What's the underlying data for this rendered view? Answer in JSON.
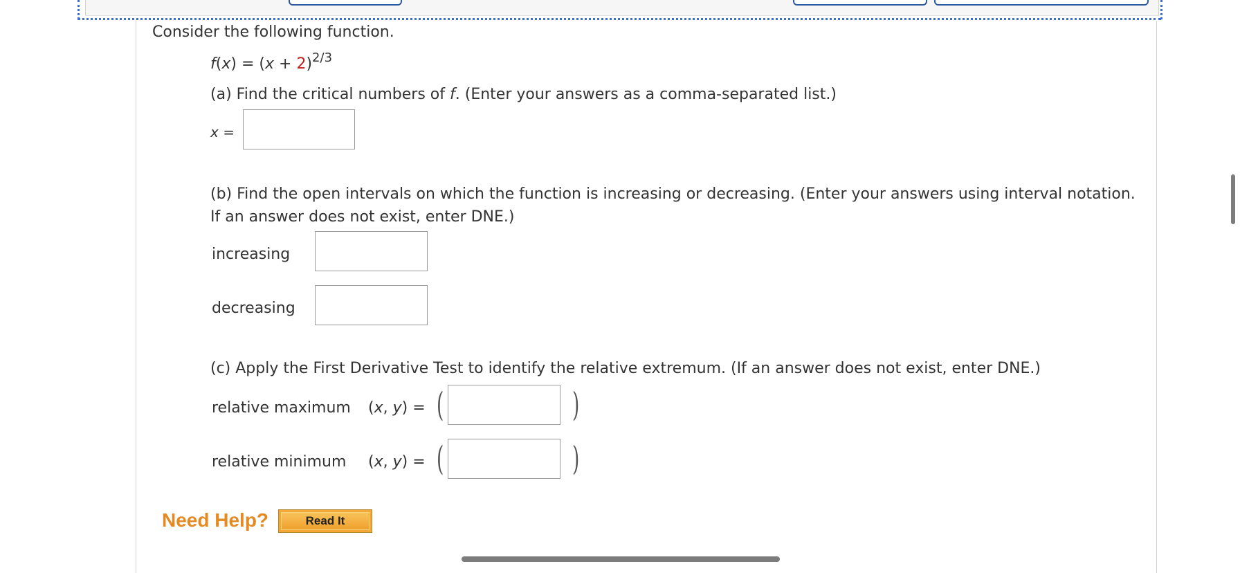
{
  "problem": {
    "intro": "Consider the following function.",
    "function": {
      "lhs_name": "f",
      "lhs_var": "x",
      "equals": "=",
      "open": "(",
      "var": "x",
      "plus": "+",
      "constant": "2",
      "close": ")",
      "exponent": "2/3"
    }
  },
  "part_a": {
    "prompt_before": "(a) Find the critical numbers of ",
    "prompt_var": "f",
    "prompt_after": ". (Enter your answers as a comma-separated list.)",
    "answer_label_var": "x",
    "answer_label_eq": "=",
    "answer_value": ""
  },
  "part_b": {
    "prompt": "(b) Find the open intervals on which the function is increasing or decreasing. (Enter your answers using interval notation. If an answer does not exist, enter DNE.)",
    "increasing_label": "increasing",
    "increasing_value": "",
    "decreasing_label": "decreasing",
    "decreasing_value": ""
  },
  "part_c": {
    "prompt": "(c) Apply the First Derivative Test to identify the relative extremum. (If an answer does not exist, enter DNE.)",
    "max_label": "relative maximum",
    "min_label": "relative minimum",
    "pair_open": "(",
    "pair_x": "x",
    "pair_comma": ", ",
    "pair_y": "y",
    "pair_close": ")",
    "pair_eq": "=",
    "paren_open": "(",
    "paren_close": ")",
    "max_value": "",
    "min_value": ""
  },
  "help": {
    "label": "Need Help?",
    "read_it": "Read It"
  },
  "colors": {
    "accent_red": "#c11c1c",
    "help_orange": "#e58a22",
    "button_orange": "#f3a937",
    "frame_blue": "#3a6fd8"
  }
}
